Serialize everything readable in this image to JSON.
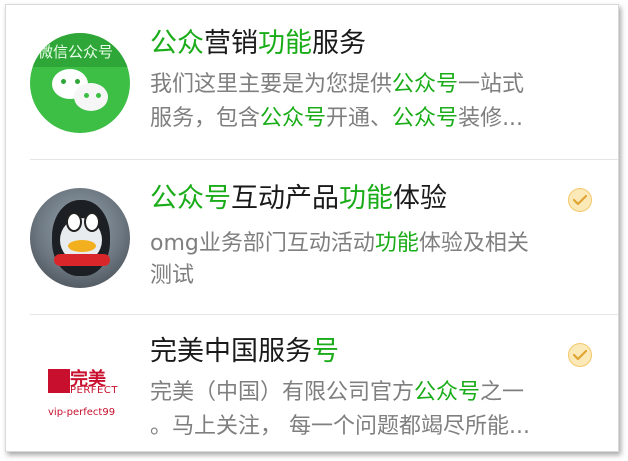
{
  "accounts": [
    {
      "title_parts": [
        {
          "text": "公众",
          "hl": true
        },
        {
          "text": "营销",
          "hl": false
        },
        {
          "text": "功能",
          "hl": true
        },
        {
          "text": "服务",
          "hl": false
        }
      ],
      "desc_line1_parts": [
        {
          "text": "我们这里主要是为您提供",
          "hl": false
        },
        {
          "text": "公众号",
          "hl": true
        },
        {
          "text": "一站式",
          "hl": false
        }
      ],
      "desc_line2_parts": [
        {
          "text": "服务，包含",
          "hl": false
        },
        {
          "text": "公众号",
          "hl": true
        },
        {
          "text": "开通、",
          "hl": false
        },
        {
          "text": "公众号",
          "hl": true
        },
        {
          "text": "装修...",
          "hl": false
        }
      ],
      "verified": false,
      "avatar": {
        "type": "wechat",
        "caption": "微信公众号"
      }
    },
    {
      "title_parts": [
        {
          "text": "公众号",
          "hl": true
        },
        {
          "text": "互动产品",
          "hl": false
        },
        {
          "text": "功能",
          "hl": true
        },
        {
          "text": "体验",
          "hl": false
        }
      ],
      "desc_line1_parts": [
        {
          "text": "omg业务部门互动活动",
          "hl": false
        },
        {
          "text": "功能",
          "hl": true
        },
        {
          "text": "体验及相关",
          "hl": false
        }
      ],
      "desc_line2_parts": [
        {
          "text": "测试",
          "hl": false
        }
      ],
      "verified": true,
      "avatar": {
        "type": "penguin"
      }
    },
    {
      "title_parts": [
        {
          "text": "完美中国服务",
          "hl": false
        },
        {
          "text": "号",
          "hl": true
        }
      ],
      "desc_line1_parts": [
        {
          "text": "完美（中国）有限公司官方",
          "hl": false
        },
        {
          "text": "公众号",
          "hl": true
        },
        {
          "text": "之一",
          "hl": false
        }
      ],
      "desc_line2_parts": [
        {
          "text": "。马上关注， 每一个问题都竭尽所能...",
          "hl": false
        }
      ],
      "verified": true,
      "avatar": {
        "type": "perfect",
        "logo_cn": "完美",
        "logo_en": "PERFECT",
        "logo_url": "vip-perfect99"
      }
    }
  ],
  "colors": {
    "highlight": "#1aad19",
    "title": "#1a1a1a",
    "desc": "#7f7f7f",
    "verified_badge": "#f3c86a"
  }
}
